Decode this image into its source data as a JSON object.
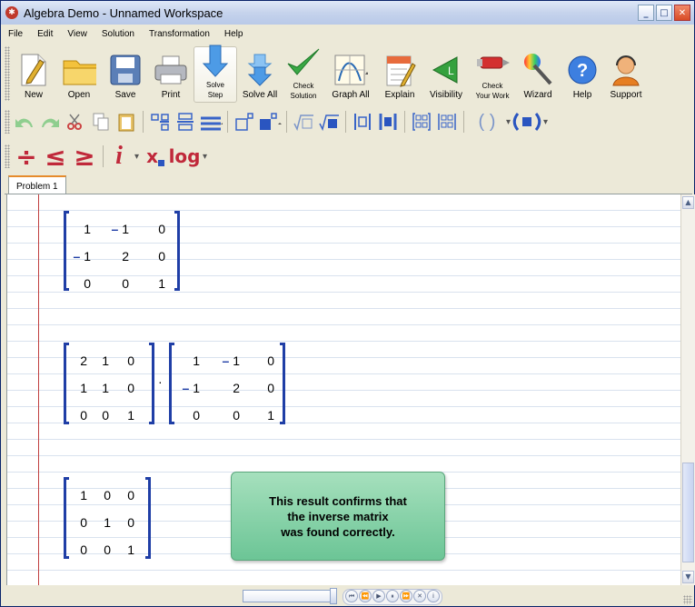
{
  "window": {
    "title": "Algebra Demo - Unnamed Workspace",
    "minimize": "_",
    "maximize": "□",
    "close": "✕"
  },
  "menu": [
    "File",
    "Edit",
    "View",
    "Solution",
    "Transformation",
    "Help"
  ],
  "toolbar": {
    "buttons": [
      {
        "label": "New",
        "icon": "new-document-icon"
      },
      {
        "label": "Open",
        "icon": "folder-icon"
      },
      {
        "label": "Save",
        "icon": "floppy-disk-icon"
      },
      {
        "label": "Print",
        "icon": "printer-icon"
      },
      {
        "label": "Solve Step",
        "label_line1": "Solve",
        "label_line2": "Step",
        "icon": "arrow-down-icon"
      },
      {
        "label": "Solve All",
        "icon": "double-arrow-down-icon"
      },
      {
        "label": "Check Solution",
        "label_line1": "Check",
        "label_line2": "Solution",
        "icon": "checkmark-icon"
      },
      {
        "label": "Graph All",
        "icon": "graph-icon"
      },
      {
        "label": "Explain",
        "icon": "notebook-icon"
      },
      {
        "label": "Visibility",
        "icon": "triangle-l-icon",
        "glyph": "L"
      },
      {
        "label": "Check Your Work",
        "label_line1": "Check",
        "label_line2": "Your Work",
        "icon": "marker-icon"
      },
      {
        "label": "Wizard",
        "icon": "wand-icon"
      },
      {
        "label": "Help",
        "icon": "help-icon",
        "glyph": "?"
      },
      {
        "label": "Support",
        "icon": "support-agent-icon"
      }
    ]
  },
  "math_toolbar": {
    "row1_icons": [
      "undo-icon",
      "redo-icon",
      "cut-icon",
      "copy-icon",
      "paste-icon",
      "fraction-icon",
      "division-bar-icon",
      "long-division-icon",
      "superscript-icon",
      "box-superscript-icon",
      "sqrt-icon",
      "nth-root-icon",
      "abs-icon",
      "bold-abs-icon",
      "matrix-icon",
      "det-icon",
      "parens-icon",
      "bold-parens-icon"
    ],
    "divide": "÷",
    "leq": "≤",
    "geq": "≥",
    "imag": "i",
    "subscript": "x",
    "log": "log",
    "caret": "▾",
    "parens": "( )"
  },
  "tabs": [
    {
      "label": "Problem 1"
    }
  ],
  "workspace": {
    "matrix_inverse": [
      [
        "1",
        "-1",
        "0"
      ],
      [
        "-1",
        "2",
        "0"
      ],
      [
        "0",
        "0",
        "1"
      ]
    ],
    "matrix_a": [
      [
        "2",
        "1",
        "0"
      ],
      [
        "1",
        "1",
        "0"
      ],
      [
        "0",
        "0",
        "1"
      ]
    ],
    "product_operator": "·",
    "matrix_b": [
      [
        "1",
        "-1",
        "0"
      ],
      [
        "-1",
        "2",
        "0"
      ],
      [
        "0",
        "0",
        "1"
      ]
    ],
    "matrix_identity": [
      [
        "1",
        "0",
        "0"
      ],
      [
        "0",
        "1",
        "0"
      ],
      [
        "0",
        "0",
        "1"
      ]
    ],
    "note_line1": "This result confirms that",
    "note_line2": "the inverse matrix",
    "note_line3": "was found correctly."
  },
  "colors": {
    "bracket": "#1f3ea6",
    "margin": "#c04040",
    "note": "#6cc596"
  },
  "player": {
    "buttons": [
      "⏮",
      "⏪",
      "▶",
      "⏸",
      "⏩",
      "✕",
      "i"
    ]
  }
}
